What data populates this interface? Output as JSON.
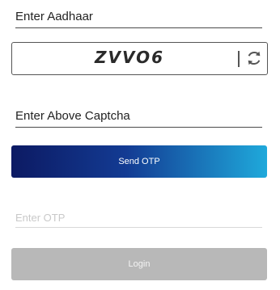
{
  "aadhaar": {
    "label": "Enter Aadhaar"
  },
  "captcha": {
    "text": "ZVVO6",
    "refresh_icon": "refresh-icon"
  },
  "captcha_input": {
    "label": "Enter Above Captcha"
  },
  "send_otp": {
    "label": "Send OTP"
  },
  "otp_input": {
    "placeholder": "Enter OTP"
  },
  "login": {
    "label": "Login"
  },
  "colors": {
    "send_otp_gradient_start": "#0c1a63",
    "send_otp_gradient_end": "#1fa9db",
    "login_disabled": "#b8b8b8"
  }
}
